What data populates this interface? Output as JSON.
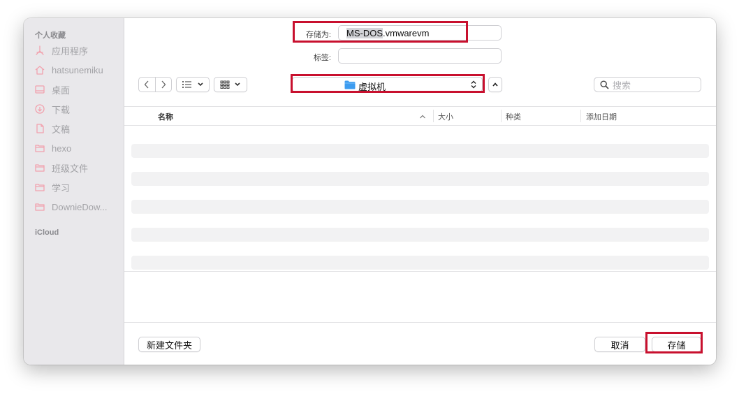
{
  "sidebar": {
    "favorites_header": "个人收藏",
    "icloud_header": "iCloud",
    "items": [
      {
        "label": "应用程序",
        "icon": "applications-icon"
      },
      {
        "label": "hatsunemiku",
        "icon": "home-icon"
      },
      {
        "label": "桌面",
        "icon": "desktop-icon"
      },
      {
        "label": "下载",
        "icon": "downloads-icon"
      },
      {
        "label": "文稿",
        "icon": "document-icon"
      },
      {
        "label": "hexo",
        "icon": "folder-icon"
      },
      {
        "label": "班级文件",
        "icon": "folder-icon"
      },
      {
        "label": "学习",
        "icon": "folder-icon"
      },
      {
        "label": "DownieDow...",
        "icon": "folder-icon"
      }
    ]
  },
  "save_as": {
    "label": "存储为:",
    "selected_part": "MS-DOS",
    "extension_part": ".vmwarevm"
  },
  "tags": {
    "label": "标签:",
    "value": ""
  },
  "toolbar": {
    "location": "虚拟机",
    "search_placeholder": "搜索"
  },
  "columns": {
    "name": "名称",
    "size": "大小",
    "kind": "种类",
    "date_added": "添加日期"
  },
  "footer": {
    "new_folder": "新建文件夹",
    "cancel": "取消",
    "save": "存储"
  },
  "colors": {
    "highlight_box": "#c8102e",
    "folder_blue": "#3d9cf0",
    "sidebar_icon": "#f2a2ae"
  }
}
